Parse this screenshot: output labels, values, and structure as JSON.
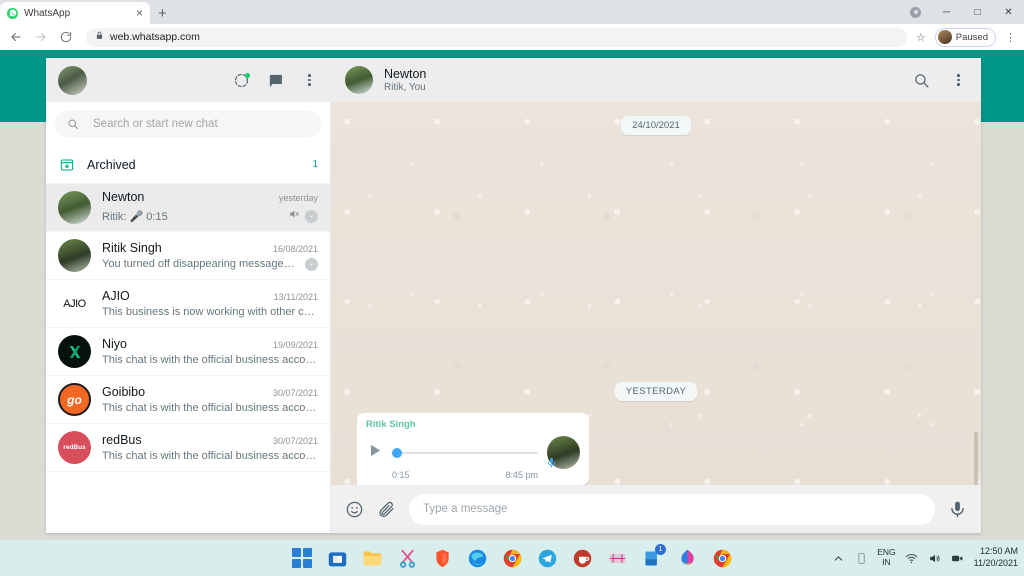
{
  "browser": {
    "tab_title": "WhatsApp",
    "tab_favicon": "whatsapp-icon",
    "tab_close": "×",
    "new_tab": "+",
    "back_icon": "back-arrow-icon",
    "forward_icon": "forward-arrow-icon",
    "reload_icon": "reload-icon",
    "lock_icon": "lock-icon",
    "url": "web.whatsapp.com",
    "bookmark_icon": "star-icon",
    "profile_label": "Paused",
    "menu_icon": "three-dot-menu-icon",
    "minimize": "─",
    "maximize": "□",
    "close": "✕"
  },
  "sidebar": {
    "header": {
      "avatar": "user-avatar",
      "status_icon": "status-ring-icon",
      "new_chat_icon": "new-chat-icon",
      "menu_icon": "three-dot-menu-icon"
    },
    "search": {
      "icon": "search-icon",
      "placeholder": "Search or start new chat",
      "value": ""
    },
    "archived": {
      "icon": "archive-icon",
      "label": "Archived",
      "count": "1"
    },
    "chats": [
      {
        "name": "Newton",
        "preview_prefix": "Ritik:",
        "preview": "0:15",
        "time": "yesterday",
        "avatar": "av-newton",
        "has_mic": true,
        "muted": true,
        "chevron": true,
        "active": true
      },
      {
        "name": "Ritik Singh",
        "preview_prefix": "",
        "preview": "You turned off disappearing messages. Click to...",
        "time": "16/08/2021",
        "avatar": "av-ritik",
        "has_mic": false,
        "muted": false,
        "chevron": true,
        "active": false
      },
      {
        "name": "AJIO",
        "preview_prefix": "",
        "preview": "This business is now working with other companie...",
        "time": "13/11/2021",
        "avatar": "av-ajio",
        "avatar_text": "AJIO",
        "has_mic": false,
        "muted": false,
        "chevron": false,
        "active": false
      },
      {
        "name": "Niyo",
        "preview_prefix": "",
        "preview": "This chat is with the official business account of Ni...",
        "time": "19/09/2021",
        "avatar": "av-niyo",
        "avatar_text": "✕",
        "has_mic": false,
        "muted": false,
        "chevron": false,
        "active": false
      },
      {
        "name": "Goibibo",
        "preview_prefix": "",
        "preview": "This chat is with the official business account of G...",
        "time": "30/07/2021",
        "avatar": "av-goibibo",
        "avatar_text": "go",
        "has_mic": false,
        "muted": false,
        "chevron": false,
        "active": false
      },
      {
        "name": "redBus",
        "preview_prefix": "",
        "preview": "This chat is with the official business account of re...",
        "time": "30/07/2021",
        "avatar": "av-redbus",
        "avatar_text": "redBus",
        "has_mic": false,
        "muted": false,
        "chevron": false,
        "active": false
      }
    ]
  },
  "chat": {
    "header": {
      "name": "Newton",
      "subtitle": "Ritik, You",
      "avatar": "av-newton",
      "search_icon": "search-icon",
      "menu_icon": "three-dot-menu-icon"
    },
    "date_divider_top": "24/10/2021",
    "date_divider_bottom": "YESTERDAY",
    "voice_message": {
      "sender": "Ritik Singh",
      "play_icon": "play-icon",
      "duration": "0:15",
      "time": "8:45 pm",
      "progress_percent": 0,
      "avatar": "av-ritik",
      "mic_badge_icon": "microphone-icon"
    },
    "footer": {
      "emoji_icon": "emoji-smiley-icon",
      "attach_icon": "paperclip-icon",
      "placeholder": "Type a message",
      "value": "",
      "mic_icon": "microphone-icon"
    }
  },
  "taskbar": {
    "items": [
      {
        "name": "start-button",
        "icon": "windows-logo-icon",
        "badge": ""
      },
      {
        "name": "microsoft-store",
        "icon": "store-icon",
        "badge": ""
      },
      {
        "name": "file-explorer",
        "icon": "folder-icon",
        "badge": ""
      },
      {
        "name": "snipping-tool",
        "icon": "snip-icon",
        "badge": ""
      },
      {
        "name": "brave-browser",
        "icon": "brave-icon",
        "badge": ""
      },
      {
        "name": "microsoft-edge",
        "icon": "edge-icon",
        "badge": ""
      },
      {
        "name": "google-chrome",
        "icon": "chrome-icon",
        "badge": ""
      },
      {
        "name": "telegram",
        "icon": "telegram-icon",
        "badge": ""
      },
      {
        "name": "coffee-app",
        "icon": "coffee-icon",
        "badge": ""
      },
      {
        "name": "media-player",
        "icon": "media-icon",
        "badge": ""
      },
      {
        "name": "mail-app",
        "icon": "mail-icon",
        "badge": "1"
      },
      {
        "name": "photos-app",
        "icon": "photos-icon",
        "badge": ""
      },
      {
        "name": "chrome-window",
        "icon": "chrome-icon",
        "badge": ""
      }
    ],
    "tray": {
      "chevron_icon": "chevron-up-icon",
      "battery_icon": "battery-icon",
      "language_line1": "ENG",
      "language_line2": "IN",
      "wifi_icon": "wifi-icon",
      "volume_icon": "speaker-icon",
      "camera_icon": "camera-icon",
      "time": "12:50 AM",
      "date": "11/20/2021"
    }
  }
}
